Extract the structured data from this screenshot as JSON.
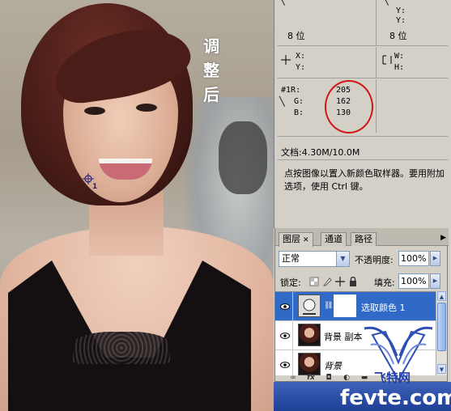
{
  "photo": {
    "caption": [
      "调",
      "整",
      "后"
    ],
    "sampler_number": "1"
  },
  "info": {
    "top_y_labels": [
      "Y:",
      "Y:"
    ],
    "bit_depth_left": "8 位",
    "bit_depth_right": "8 位",
    "xy_labels": [
      "X:",
      "Y:"
    ],
    "wh_labels": [
      "W:",
      "H:"
    ],
    "sampler": {
      "label": "#1",
      "channels": [
        {
          "name": "R:",
          "value": "205"
        },
        {
          "name": "G:",
          "value": "162"
        },
        {
          "name": "B:",
          "value": "130"
        }
      ]
    },
    "doc_size": "文档:4.30M/10.0M",
    "hint": "点按图像以置入新颜色取样器。要用附加选项，使用 Ctrl 键。"
  },
  "layers_panel": {
    "tabs": [
      "图层",
      "通道",
      "路径"
    ],
    "blend_mode": "正常",
    "opacity_label": "不透明度:",
    "opacity_value": "100%",
    "lock_label": "锁定:",
    "fill_label": "填充:",
    "fill_value": "100%",
    "layers": [
      {
        "name": "选取颜色 1",
        "selected": true
      },
      {
        "name": "背景 副本",
        "selected": false
      },
      {
        "name": "背景",
        "selected": false
      }
    ]
  },
  "watermark": {
    "site": "fevte.com",
    "brand": "飞特网"
  },
  "colors": {
    "selection": "#3169c6",
    "panel_bg": "#d4d0c8",
    "annotation_ring": "#d01818",
    "watermark_band": "#2a4ea6"
  }
}
